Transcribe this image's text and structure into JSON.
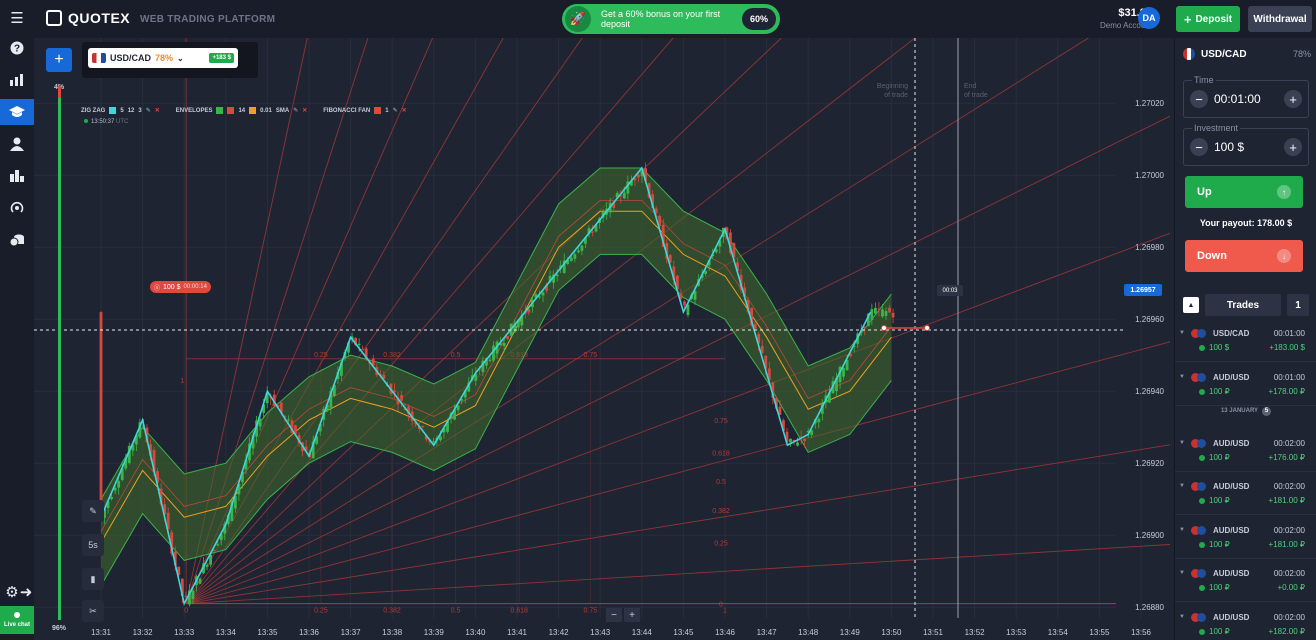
{
  "brand": {
    "name": "QUOTEX",
    "tagline": "WEB TRADING PLATFORM"
  },
  "promo": {
    "text": "Get a 60% bonus on your first deposit",
    "percent": "60%"
  },
  "account": {
    "balance": "$31.80",
    "type": "Demo Account",
    "initials": "DA"
  },
  "header_buttons": {
    "deposit": "Deposit",
    "withdraw": "Withdrawal"
  },
  "chart_header": {
    "asset": "USD/CAD",
    "payout": "78%",
    "gain_badge": "+183 $",
    "time": "13:50:37",
    "tz": "UTC"
  },
  "indicators": {
    "zigzag": {
      "name": "ZIG ZAG",
      "color": "#3fd6e0",
      "p1": "5",
      "p2": "12",
      "p3": "3"
    },
    "envelopes": {
      "name": "ENVELOPES",
      "color1": "#39b54a",
      "color2": "#e0473d",
      "p1": "14",
      "color3": "#f0a020",
      "p2": "0.01",
      "p3": "SMA"
    },
    "fib": {
      "name": "FIBONACCI FAN",
      "color": "#e0473d",
      "p1": "1"
    }
  },
  "sentiment": {
    "top": "4%",
    "bottom": "96%"
  },
  "chart_labels": {
    "beginning": [
      "Beginning",
      "of trade"
    ],
    "end": [
      "End",
      "of trade"
    ],
    "current_price": "1.26957",
    "trade_tag": {
      "amount": "100 $",
      "timer": "00:00:14"
    },
    "expiry_timer": "00:03",
    "timeframe": "5s"
  },
  "chart_data": {
    "type": "line",
    "yticks": [
      "1.27020",
      "1.27000",
      "1.26980",
      "1.26960",
      "1.26940",
      "1.26920",
      "1.26900",
      "1.26880"
    ],
    "xticks": [
      "13:31",
      "13:32",
      "13:33",
      "13:34",
      "13:35",
      "13:36",
      "13:37",
      "13:38",
      "13:39",
      "13:40",
      "13:41",
      "13:42",
      "13:43",
      "13:44",
      "13:45",
      "13:46",
      "13:47",
      "13:48",
      "13:49",
      "13:50",
      "13:51",
      "13:52",
      "13:53",
      "13:54",
      "13:55",
      "13:56"
    ],
    "ylim": [
      1.26877,
      1.27027
    ],
    "fib_levels": [
      "0",
      "0.25",
      "0.382",
      "0.5",
      "0.618",
      "0.75",
      "1"
    ],
    "fib_levels_upper": [
      "0.25",
      "0.382",
      "0.5",
      "0.618",
      "0.75"
    ],
    "fib_levels_right": [
      "0.75",
      "0.618",
      "0.5",
      "0.382",
      "0.25",
      "0"
    ],
    "zigzag": [
      [
        13.31,
        1.26905
      ],
      [
        13.32,
        1.26932
      ],
      [
        13.33,
        1.26881
      ],
      [
        13.34,
        1.26903
      ],
      [
        13.35,
        1.2694
      ],
      [
        13.36,
        1.26922
      ],
      [
        13.37,
        1.26955
      ],
      [
        13.39,
        1.26925
      ],
      [
        13.4,
        1.26945
      ],
      [
        13.44,
        1.27002
      ],
      [
        13.45,
        1.26962
      ],
      [
        13.46,
        1.26985
      ],
      [
        13.475,
        1.26925
      ],
      [
        13.48,
        1.26928
      ],
      [
        13.495,
        1.26962
      ]
    ],
    "ma_center": [
      [
        13.31,
        1.26898
      ],
      [
        13.32,
        1.26918
      ],
      [
        13.33,
        1.26905
      ],
      [
        13.34,
        1.26908
      ],
      [
        13.35,
        1.26922
      ],
      [
        13.36,
        1.26932
      ],
      [
        13.37,
        1.26938
      ],
      [
        13.38,
        1.26935
      ],
      [
        13.39,
        1.2693
      ],
      [
        13.4,
        1.26936
      ],
      [
        13.41,
        1.26958
      ],
      [
        13.42,
        1.2698
      ],
      [
        13.43,
        1.2699
      ],
      [
        13.44,
        1.2699
      ],
      [
        13.45,
        1.26978
      ],
      [
        13.46,
        1.26972
      ],
      [
        13.47,
        1.26955
      ],
      [
        13.48,
        1.26935
      ],
      [
        13.49,
        1.2694
      ],
      [
        13.5,
        1.26955
      ]
    ],
    "current_price": 1.26957,
    "trade_open_price": 1.26957
  },
  "panel": {
    "asset": "USD/CAD",
    "payout": "78%",
    "time_label": "Time",
    "time_value": "00:01:00",
    "investment_label": "Investment",
    "investment_value": "100 $",
    "up": "Up",
    "down": "Down",
    "payout_text": "Your payout: 178.00 $",
    "trades_title": "Trades",
    "trades_count": "1",
    "date_sep": "13 JANUARY",
    "date_sep_count": "5"
  },
  "trades": [
    {
      "pair": "USD/CAD",
      "duration": "00:01:00",
      "stake": "100 $",
      "profit": "+183.00 $",
      "flags": [
        "#1f4e9e",
        "#c8322f"
      ]
    },
    {
      "pair": "AUD/USD",
      "duration": "00:01:00",
      "stake": "100 ₽",
      "profit": "+178.00 ₽",
      "flags": [
        "#1f4e9e",
        "#c8322f"
      ]
    },
    {
      "pair": "AUD/USD",
      "duration": "00:02:00",
      "stake": "100 ₽",
      "profit": "+176.00 ₽",
      "flags": [
        "#1f4e9e",
        "#c8322f"
      ]
    },
    {
      "pair": "AUD/USD",
      "duration": "00:02:00",
      "stake": "100 ₽",
      "profit": "+181.00 ₽",
      "flags": [
        "#1f4e9e",
        "#c8322f"
      ]
    },
    {
      "pair": "AUD/USD",
      "duration": "00:02:00",
      "stake": "100 ₽",
      "profit": "+181.00 ₽",
      "flags": [
        "#1f4e9e",
        "#c8322f"
      ]
    },
    {
      "pair": "AUD/USD",
      "duration": "00:02:00",
      "stake": "100 ₽",
      "profit": "+0.00 ₽",
      "flags": [
        "#1f4e9e",
        "#c8322f"
      ]
    },
    {
      "pair": "AUD/USD",
      "duration": "00:02:00",
      "stake": "100 ₽",
      "profit": "+182.00 ₽",
      "flags": [
        "#1f4e9e",
        "#c8322f"
      ]
    }
  ],
  "bottom": {
    "live_chat": "Live chat"
  },
  "icons": [
    "menu-icon",
    "help-icon",
    "chart-bars-icon",
    "education-icon",
    "user-icon",
    "leaderboard-icon",
    "signal-icon",
    "coins-icon",
    "settings-icon",
    "exit-icon"
  ]
}
